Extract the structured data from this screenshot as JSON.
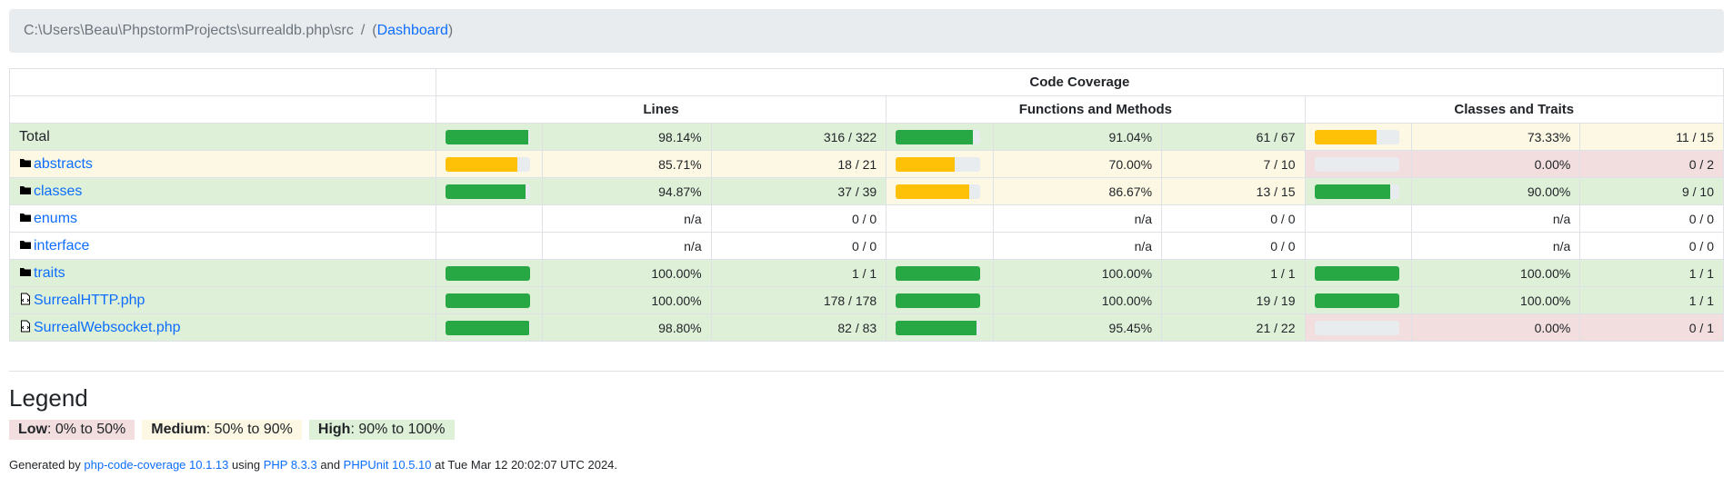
{
  "breadcrumb": {
    "path": "C:\\Users\\Beau\\PhpstormProjects\\surrealdb.php\\src",
    "separator": "/",
    "open_paren": "(",
    "dashboard": "Dashboard",
    "close_paren": ")"
  },
  "table": {
    "group_header": "Code Coverage",
    "headers": {
      "lines": "Lines",
      "functions": "Functions and Methods",
      "classes": "Classes and Traits"
    },
    "rows": [
      {
        "name": "Total",
        "icon": "",
        "link": false,
        "lines": {
          "pct": "98.14%",
          "count": "316 / 322",
          "level": "high",
          "bar": 98.14
        },
        "funcs": {
          "pct": "91.04%",
          "count": "61 / 67",
          "level": "high",
          "bar": 91.04
        },
        "classes": {
          "pct": "73.33%",
          "count": "11 / 15",
          "level": "medium",
          "bar": 73.33
        }
      },
      {
        "name": "abstracts",
        "icon": "folder-icon",
        "link": true,
        "lines": {
          "pct": "85.71%",
          "count": "18 / 21",
          "level": "medium",
          "bar": 85.71
        },
        "funcs": {
          "pct": "70.00%",
          "count": "7 / 10",
          "level": "medium",
          "bar": 70.0
        },
        "classes": {
          "pct": "0.00%",
          "count": "0 / 2",
          "level": "low",
          "bar": 0
        }
      },
      {
        "name": "classes",
        "icon": "folder-icon",
        "link": true,
        "lines": {
          "pct": "94.87%",
          "count": "37 / 39",
          "level": "high",
          "bar": 94.87
        },
        "funcs": {
          "pct": "86.67%",
          "count": "13 / 15",
          "level": "medium",
          "bar": 86.67
        },
        "classes": {
          "pct": "90.00%",
          "count": "9 / 10",
          "level": "high",
          "bar": 90.0
        }
      },
      {
        "name": "enums",
        "icon": "folder-icon",
        "link": true,
        "lines": {
          "pct": "n/a",
          "count": "0 / 0",
          "level": "na",
          "bar": null
        },
        "funcs": {
          "pct": "n/a",
          "count": "0 / 0",
          "level": "na",
          "bar": null
        },
        "classes": {
          "pct": "n/a",
          "count": "0 / 0",
          "level": "na",
          "bar": null
        }
      },
      {
        "name": "interface",
        "icon": "folder-icon",
        "link": true,
        "lines": {
          "pct": "n/a",
          "count": "0 / 0",
          "level": "na",
          "bar": null
        },
        "funcs": {
          "pct": "n/a",
          "count": "0 / 0",
          "level": "na",
          "bar": null
        },
        "classes": {
          "pct": "n/a",
          "count": "0 / 0",
          "level": "na",
          "bar": null
        }
      },
      {
        "name": "traits",
        "icon": "folder-icon",
        "link": true,
        "lines": {
          "pct": "100.00%",
          "count": "1 / 1",
          "level": "high",
          "bar": 100
        },
        "funcs": {
          "pct": "100.00%",
          "count": "1 / 1",
          "level": "high",
          "bar": 100
        },
        "classes": {
          "pct": "100.00%",
          "count": "1 / 1",
          "level": "high",
          "bar": 100
        }
      },
      {
        "name": "SurrealHTTP.php",
        "icon": "code-file-icon",
        "link": true,
        "lines": {
          "pct": "100.00%",
          "count": "178 / 178",
          "level": "high",
          "bar": 100
        },
        "funcs": {
          "pct": "100.00%",
          "count": "19 / 19",
          "level": "high",
          "bar": 100
        },
        "classes": {
          "pct": "100.00%",
          "count": "1 / 1",
          "level": "high",
          "bar": 100
        }
      },
      {
        "name": "SurrealWebsocket.php",
        "icon": "code-file-icon",
        "link": true,
        "lines": {
          "pct": "98.80%",
          "count": "82 / 83",
          "level": "high",
          "bar": 98.8
        },
        "funcs": {
          "pct": "95.45%",
          "count": "21 / 22",
          "level": "high",
          "bar": 95.45
        },
        "classes": {
          "pct": "0.00%",
          "count": "0 / 1",
          "level": "low",
          "bar": 0
        }
      }
    ]
  },
  "legend": {
    "title": "Legend",
    "low_label": "Low",
    "low_range": ": 0% to 50%",
    "medium_label": "Medium",
    "medium_range": ": 50% to 90%",
    "high_label": "High",
    "high_range": ": 90% to 100%"
  },
  "footer": {
    "generated_by": "Generated by ",
    "tool": "php-code-coverage 10.1.13",
    "using": " using ",
    "php": "PHP 8.3.3",
    "and": " and ",
    "phpunit": "PHPUnit 10.5.10",
    "at": " at Tue Mar 12 20:02:07 UTC 2024."
  },
  "colors": {
    "high_bg": "#dff0d8",
    "medium_bg": "#fcf8e3",
    "low_bg": "#f2dede",
    "bar_high": "#28a745",
    "bar_medium": "#ffc107",
    "link": "#0d6efd"
  }
}
